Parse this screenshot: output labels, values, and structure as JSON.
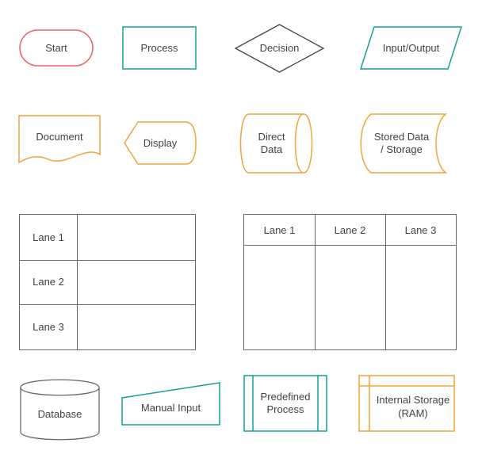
{
  "colors": {
    "teal": "#14a19a",
    "orange": "#f2a33c",
    "red": "#ee6666",
    "gray": "#686868"
  },
  "shapes": {
    "start": "Start",
    "process": "Process",
    "decision": "Decision",
    "io": "Input/Output",
    "document": "Document",
    "display": "Display",
    "direct_data": "Direct Data",
    "stored_data": "Stored Data / Storage",
    "database": "Database",
    "manual_input": "Manual Input",
    "predefined": "Predefined Process",
    "internal": "Internal Storage (RAM)"
  },
  "swim_h": {
    "lane1": "Lane 1",
    "lane2": "Lane 2",
    "lane3": "Lane 3"
  },
  "swim_v": {
    "lane1": "Lane 1",
    "lane2": "Lane 2",
    "lane3": "Lane 3"
  }
}
